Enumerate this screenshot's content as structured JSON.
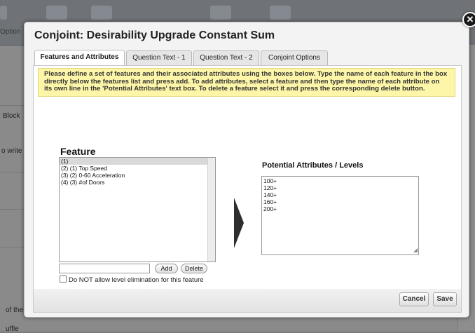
{
  "background": {
    "options_label": "Option",
    "block_label": "Block",
    "write_label": "o write",
    "of_the_label": "of the",
    "bottom_label": "uffle"
  },
  "dialog": {
    "title": "Conjoint: Desirability Upgrade Constant Sum",
    "close_icon": "close-icon",
    "tabs": [
      {
        "label": "Features and Attributes",
        "active": true
      },
      {
        "label": "Question Text - 1",
        "active": false
      },
      {
        "label": "Question Text - 2",
        "active": false
      },
      {
        "label": "Conjoint Options",
        "active": false
      }
    ],
    "instructions": "Please define a set of features and their associated attributes using the boxes below. Type the name of each feature in the box directly below the features list and press add. To add attributes, select a feature and then type the name of each attribute on its own line in the 'Potential Attributes' text box. To delete a feature select it and press the corresponding delete button.",
    "feature_heading": "Feature",
    "features": [
      "(1)",
      "(2) (1) Top Speed",
      "(3) (2) 0-60 Acceleration",
      "(4) (3) #of Doors"
    ],
    "selected_feature_index": 0,
    "feature_input": {
      "value": "",
      "placeholder": ""
    },
    "add_label": "Add",
    "delete_label": "Delete",
    "checkbox_label": "Do NOT allow level elimination for this feature",
    "checkbox_checked": false,
    "attributes_heading": "Potential Attributes / Levels",
    "attributes": [
      "100+",
      "120+",
      "140+",
      "160+",
      "200+"
    ],
    "cancel_label": "Cancel",
    "save_label": "Save"
  },
  "colors": {
    "instructions_bg": "#fdf6a8",
    "overlay": "#8a8a8a"
  }
}
